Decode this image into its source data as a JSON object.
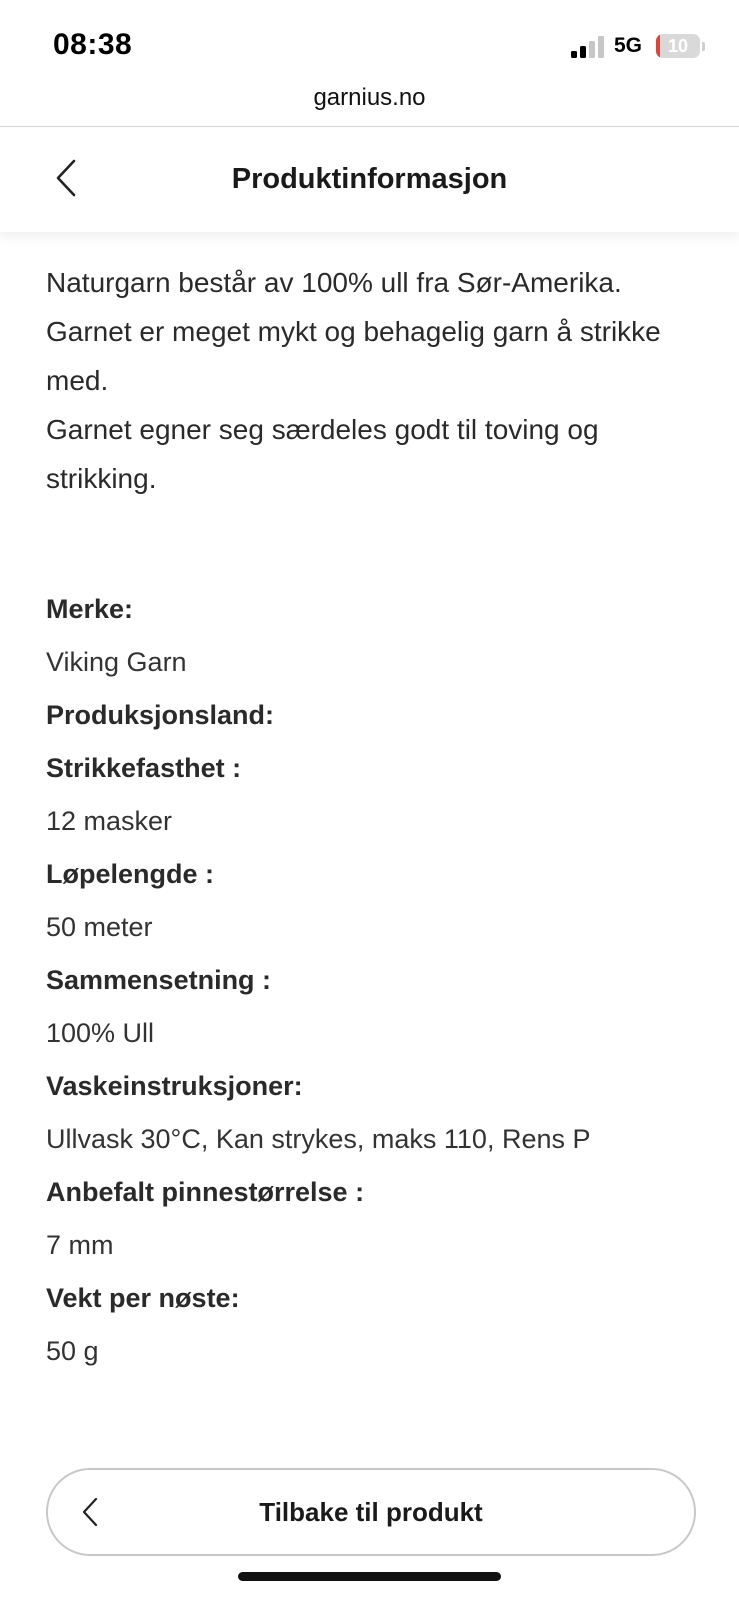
{
  "status_bar": {
    "time": "08:38",
    "network": "5G",
    "battery": "10",
    "battery_level": 0.1
  },
  "browser": {
    "url": "garnius.no"
  },
  "header": {
    "title": "Produktinformasjon",
    "back_icon": "chevron-left-icon"
  },
  "description": {
    "paragraph_1": "Naturgarn består av 100% ull fra Sør-Amerika. Garnet er meget mykt og behagelig garn å strikke med.",
    "paragraph_2": "Garnet egner seg særdeles godt til toving og strikking."
  },
  "specs": {
    "merke_label": "Merke:",
    "merke_value": "Viking Garn",
    "produksjonsland_label": "Produksjonsland:",
    "strikkefasthet_label": "Strikkefasthet :",
    "strikkefasthet_value": "12 masker",
    "lopelengde_label": "Løpelengde :",
    "lopelengde_value": "50 meter",
    "sammensetning_label": "Sammensetning :",
    "sammensetning_value": "100% Ull",
    "vaskeinstruksjoner_label": "Vaskeinstruksjoner:",
    "vaskeinstruksjoner_value": "Ullvask 30°C, Kan strykes, maks 110, Rens P",
    "pinnestorrelse_label": "Anbefalt pinnestørrelse :",
    "pinnestorrelse_value": "7 mm",
    "vekt_label": "Vekt per nøste:",
    "vekt_value": "50 g"
  },
  "footer": {
    "back_to_product_label": "Tilbake til produkt",
    "back_icon": "chevron-left-icon"
  },
  "colors": {
    "text": "#2a2a2a",
    "battery_low": "#e0433a",
    "button_border": "#c8c8c8"
  }
}
